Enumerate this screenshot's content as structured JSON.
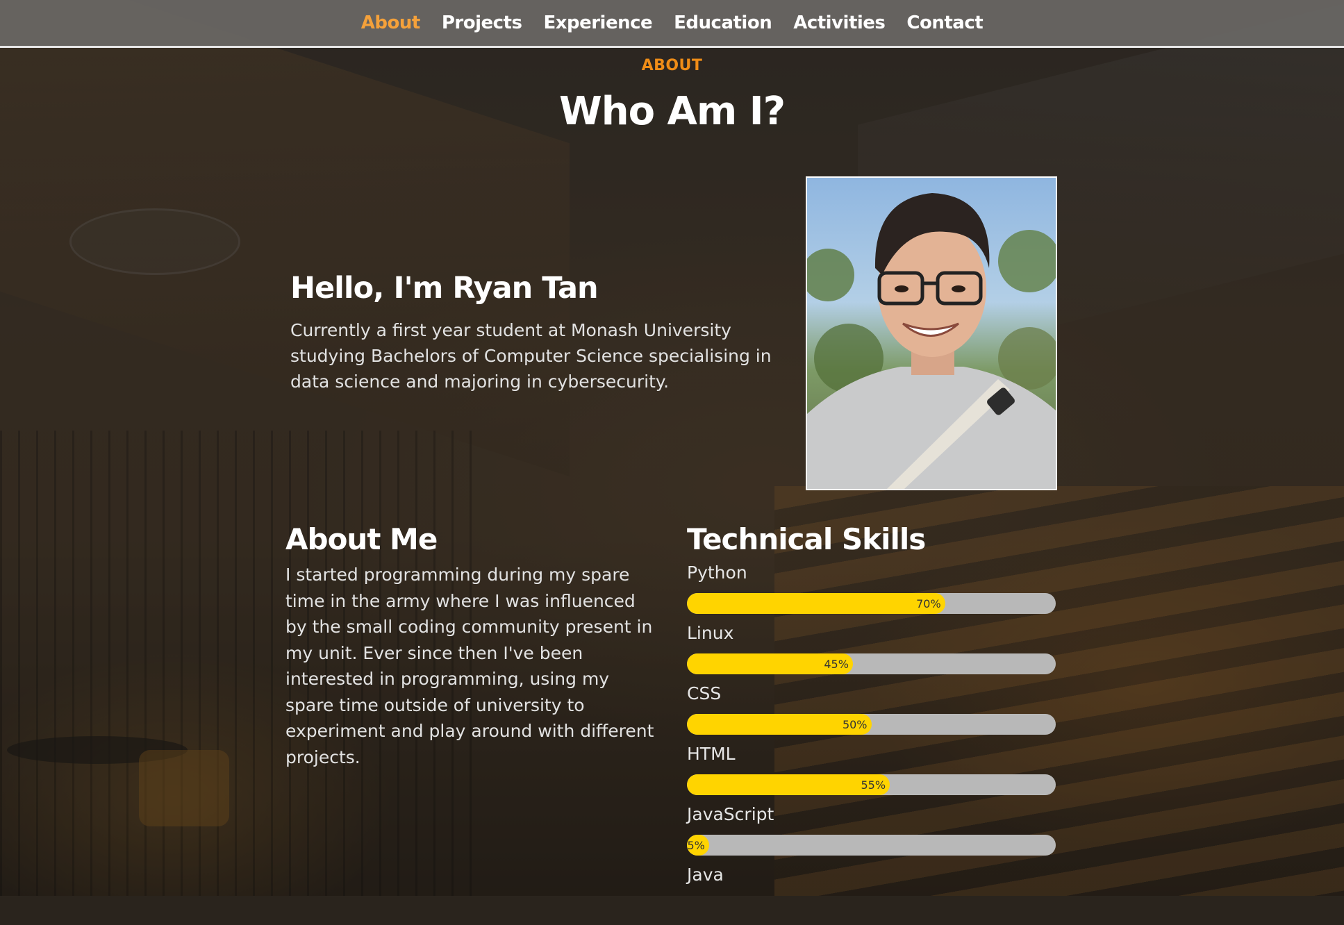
{
  "nav": {
    "items": [
      {
        "label": "About",
        "active": true
      },
      {
        "label": "Projects",
        "active": false
      },
      {
        "label": "Experience",
        "active": false
      },
      {
        "label": "Education",
        "active": false
      },
      {
        "label": "Activities",
        "active": false
      },
      {
        "label": "Contact",
        "active": false
      }
    ]
  },
  "colors": {
    "accent": "#f08d17",
    "skill_bar_fill": "#ffd400",
    "skill_bar_track": "#b8b8b8"
  },
  "section": {
    "eyebrow": "ABOUT",
    "title": "Who Am I?"
  },
  "intro": {
    "greeting": "Hello, I'm Ryan Tan",
    "text": "Currently a first year student at Monash University studying Bachelors of Computer Science specialising in data science and majoring in cybersecurity."
  },
  "about": {
    "heading": "About Me",
    "text": "I started programming during my spare time in the army where I was influenced by the small coding community present in my unit. Ever since then I've been interested in programming, using my spare time outside of university to experiment and play around with different projects."
  },
  "skills": {
    "heading": "Technical Skills",
    "items": [
      {
        "name": "Python",
        "percent": 70,
        "label": "70%"
      },
      {
        "name": "Linux",
        "percent": 45,
        "label": "45%"
      },
      {
        "name": "CSS",
        "percent": 50,
        "label": "50%"
      },
      {
        "name": "HTML",
        "percent": 55,
        "label": "55%"
      },
      {
        "name": "JavaScript",
        "percent": 5,
        "label": "5%"
      },
      {
        "name": "Java",
        "percent": null,
        "label": ""
      }
    ]
  }
}
